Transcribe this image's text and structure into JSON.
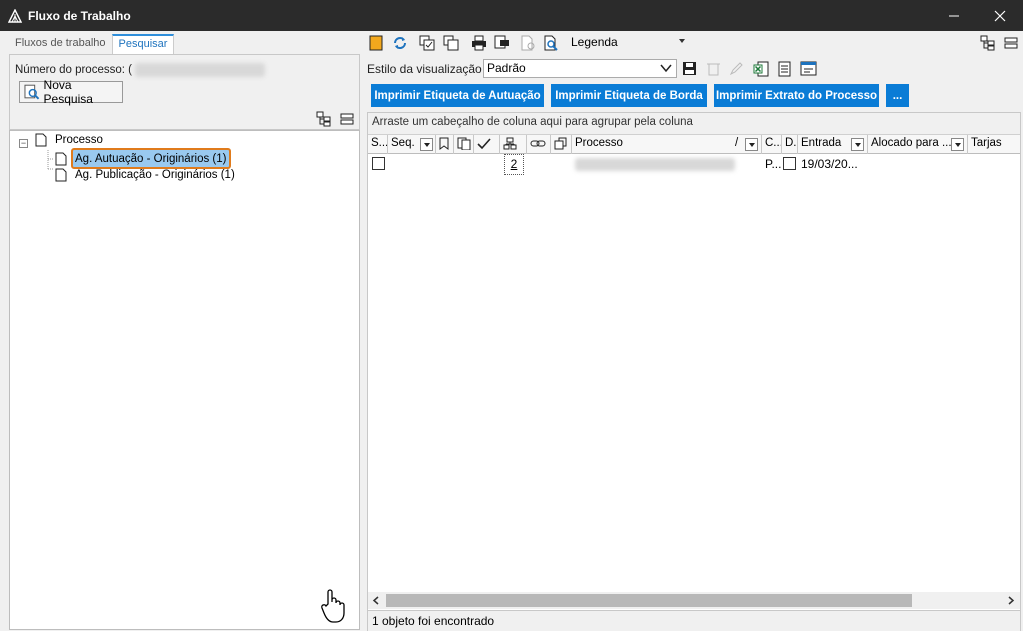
{
  "window": {
    "title": "Fluxo de Trabalho"
  },
  "left": {
    "tabs": [
      {
        "label": "Fluxos de trabalho"
      },
      {
        "label": "Pesquisar"
      }
    ],
    "search": {
      "process_number_label": "Número do processo: (",
      "nova_pesquisa": "Nova Pesquisa"
    },
    "tree": {
      "root": "Processo",
      "children": [
        {
          "label": "Ag. Autuação - Originários (1)"
        },
        {
          "label": "Ag. Publicação - Originários (1)"
        }
      ]
    }
  },
  "right": {
    "toolbar": {
      "legend_label": "Legenda"
    },
    "view_style": {
      "label": "Estilo da visualização",
      "value": "Padrão"
    },
    "buttons": [
      {
        "label": "Imprimir Etiqueta de Autuação"
      },
      {
        "label": "Imprimir Etiqueta de Borda"
      },
      {
        "label": "Imprimir Extrato do Processo"
      },
      {
        "label": "..."
      }
    ],
    "grid": {
      "group_hint": "Arraste um cabeçalho de coluna aqui para agrupar pela coluna",
      "columns": {
        "s": "S...",
        "seq": "Seq.",
        "processo": "Processo",
        "sort": "/",
        "c": "C...",
        "d": "D.",
        "entrada": "Entrada",
        "alocado": "Alocado para ...",
        "tarjas": "Tarjas"
      },
      "row": {
        "count": "2",
        "c_value": "P...",
        "entrada": "19/03/20..."
      }
    },
    "status": "1 objeto foi encontrado"
  }
}
